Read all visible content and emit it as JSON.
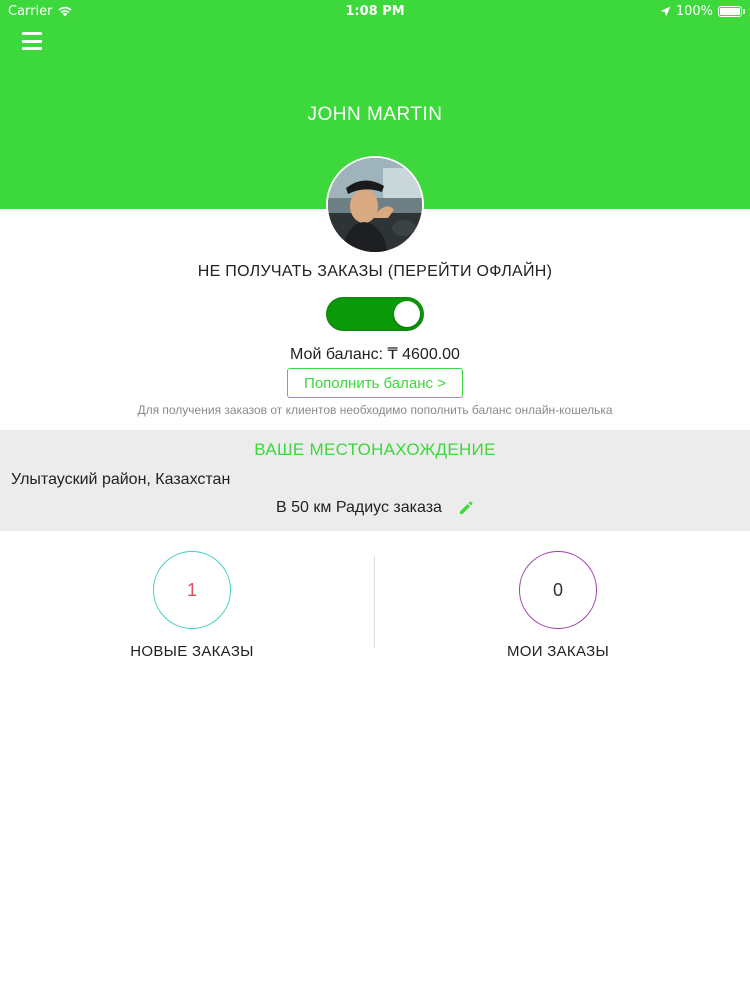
{
  "status_bar": {
    "carrier": "Carrier",
    "time": "1:08 PM",
    "battery": "100%"
  },
  "header": {
    "driver_name": "JOHN MARTIN",
    "background_color": "#3cd83c"
  },
  "availability": {
    "label": "НЕ ПОЛУЧАТЬ ЗАКАЗЫ (ПЕРЕЙТИ ОФЛАЙН)",
    "toggle_on": true
  },
  "balance": {
    "text": "Мой баланс: ₸ 4600.00",
    "topup_label": "Пополнить баланс >",
    "note": "Для получения заказов от клиентов необходимо пополнить баланс онлайн-кошелька"
  },
  "location": {
    "title": "ВАШЕ МЕСТОНАХОЖДЕНИЕ",
    "address": "Улытауский район,  Казахстан",
    "radius_text": "В 50 км Радиус заказа",
    "edit_icon": "pencil-icon"
  },
  "orders": {
    "new": {
      "count": "1",
      "label": "НОВЫЕ ЗАКАЗЫ"
    },
    "mine": {
      "count": "0",
      "label": "МОИ ЗАКАЗЫ"
    }
  }
}
